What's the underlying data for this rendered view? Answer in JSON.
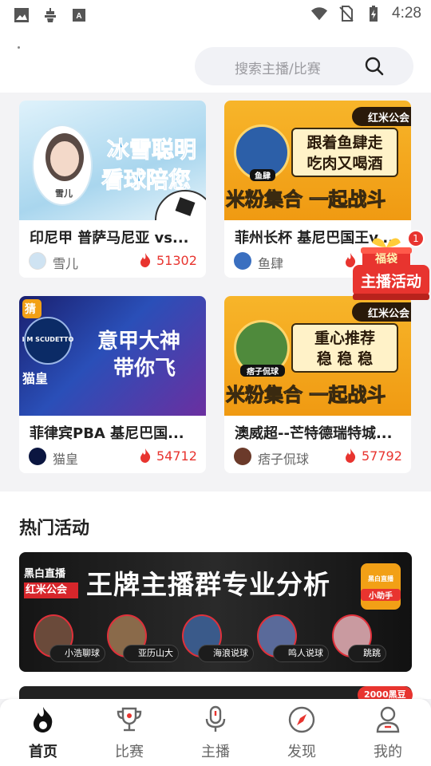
{
  "status_bar": {
    "time": "4:28"
  },
  "search": {
    "placeholder": "搜索主播/比赛"
  },
  "cards": [
    {
      "thumb_line1": "冰雪聪明",
      "thumb_line2": "看球陪您",
      "thumb_name": "雪儿",
      "title": "印尼甲 普萨马尼亚 vs...",
      "streamer": "雪儿",
      "count": "51302"
    },
    {
      "thumb_badge": "红米公会",
      "thumb_line1": "跟着鱼肆走",
      "thumb_line2": "吃肉又喝酒",
      "thumb_name": "鱼肆",
      "thumb_bottom": "米粉集合 一起战斗",
      "title": "菲州长杯 基尼巴国王v...",
      "streamer": "鱼肆",
      "count": ""
    },
    {
      "thumb_corner": "猜",
      "thumb_logo": "I M SCUDETTO",
      "thumb_line1": "意甲大神",
      "thumb_line2": "带你飞",
      "thumb_name": "猫皇",
      "title": "菲律宾PBA 基尼巴国...",
      "streamer": "猫皇",
      "count": "54712"
    },
    {
      "thumb_badge": "红米公会",
      "thumb_line1": "重心推荐",
      "thumb_line2": "稳 稳 稳",
      "thumb_name": "痞子侃球",
      "thumb_bottom": "米粉集合 一起战斗",
      "title": "澳威超--芒特德瑞特城...",
      "streamer": "痞子侃球",
      "count": "57792"
    }
  ],
  "floating_activity": {
    "badge": "1",
    "label": "主播活动",
    "top_text": "福袋"
  },
  "hot_activities": {
    "title": "热门活动",
    "banner": {
      "brand_line1": "黑白直播",
      "brand_line2": "红米公会",
      "headline": "王牌主播群专业分析",
      "helper_line1": "黑白直播",
      "helper_line2": "小助手",
      "hosts": [
        "小浩聊球",
        "亚历山大",
        "海浪说球",
        "鸣人说球",
        "跳跳"
      ]
    },
    "peek_badge": "2000黑豆"
  },
  "bottom_nav": [
    {
      "label": "首页",
      "icon": "flame-icon",
      "active": true
    },
    {
      "label": "比赛",
      "icon": "trophy-icon",
      "active": false
    },
    {
      "label": "主播",
      "icon": "microphone-icon",
      "active": false
    },
    {
      "label": "发现",
      "icon": "compass-icon",
      "active": false
    },
    {
      "label": "我的",
      "icon": "profile-icon",
      "active": false
    }
  ],
  "colors": {
    "accent": "#e8342f",
    "gold": "#f2a016",
    "background": "#f3f3f5"
  }
}
